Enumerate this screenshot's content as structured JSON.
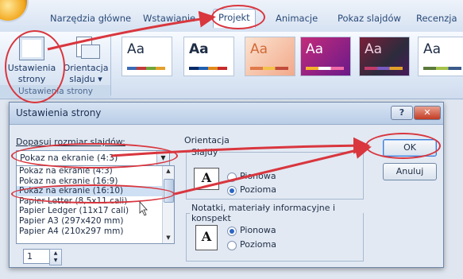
{
  "ribbon": {
    "tabs": [
      "Narzędzia główne",
      "Wstawianie",
      "Projekt",
      "Animacje",
      "Pokaz slajdów",
      "Recenzja"
    ],
    "active_tab": "Projekt",
    "page_setup": {
      "label_line1": "Ustawienia",
      "label_line2": "strony"
    },
    "orientation": {
      "label_line1": "Orientacja",
      "label_line2": "slajdu ▾"
    },
    "group_label": "Ustawienia strony",
    "theme_sample": "Aa"
  },
  "dialog": {
    "title": "Ustawienia strony",
    "help": "?",
    "close": "✕",
    "size_label": "Dopasuj rozmiar slajdów:",
    "size_value": "Pokaz na ekranie (4:3)",
    "size_options": [
      "Pokaz na ekranie (4:3)",
      "Pokaz na ekranie (16:9)",
      "Pokaz na ekranie (16:10)",
      "Papier Letter (8,5x11 cali)",
      "Papier Ledger (11x17 cali)",
      "Papier A3 (297x420 mm)",
      "Papier A4 (210x297 mm)"
    ],
    "selected_option_index": 2,
    "start_number": "1",
    "orientation_label": "Orientacja",
    "slides_label": "Slajdy",
    "portrait": "Pionowa",
    "landscape": "Pozioma",
    "slides_selected": "Pozioma",
    "notes_label": "Notatki, materiały informacyjne i konspekt",
    "notes_selected": "Pionowa",
    "page_glyph": "A",
    "ok": "OK",
    "cancel": "Anuluj"
  },
  "colors": {
    "annotation": "#d9363e",
    "selection": "#2b65c4"
  }
}
